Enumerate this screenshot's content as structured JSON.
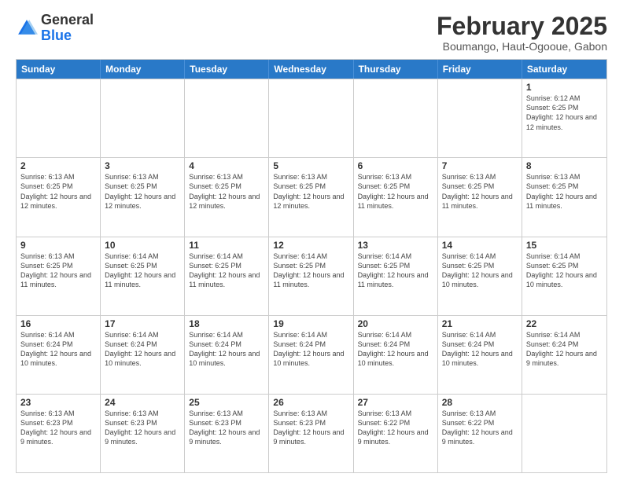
{
  "header": {
    "logo": {
      "general": "General",
      "blue": "Blue"
    },
    "title": "February 2025",
    "subtitle": "Boumango, Haut-Ogooue, Gabon"
  },
  "days_of_week": [
    "Sunday",
    "Monday",
    "Tuesday",
    "Wednesday",
    "Thursday",
    "Friday",
    "Saturday"
  ],
  "weeks": [
    [
      {
        "day": "",
        "info": ""
      },
      {
        "day": "",
        "info": ""
      },
      {
        "day": "",
        "info": ""
      },
      {
        "day": "",
        "info": ""
      },
      {
        "day": "",
        "info": ""
      },
      {
        "day": "",
        "info": ""
      },
      {
        "day": "1",
        "info": "Sunrise: 6:12 AM\nSunset: 6:25 PM\nDaylight: 12 hours and 12 minutes."
      }
    ],
    [
      {
        "day": "2",
        "info": "Sunrise: 6:13 AM\nSunset: 6:25 PM\nDaylight: 12 hours and 12 minutes."
      },
      {
        "day": "3",
        "info": "Sunrise: 6:13 AM\nSunset: 6:25 PM\nDaylight: 12 hours and 12 minutes."
      },
      {
        "day": "4",
        "info": "Sunrise: 6:13 AM\nSunset: 6:25 PM\nDaylight: 12 hours and 12 minutes."
      },
      {
        "day": "5",
        "info": "Sunrise: 6:13 AM\nSunset: 6:25 PM\nDaylight: 12 hours and 12 minutes."
      },
      {
        "day": "6",
        "info": "Sunrise: 6:13 AM\nSunset: 6:25 PM\nDaylight: 12 hours and 11 minutes."
      },
      {
        "day": "7",
        "info": "Sunrise: 6:13 AM\nSunset: 6:25 PM\nDaylight: 12 hours and 11 minutes."
      },
      {
        "day": "8",
        "info": "Sunrise: 6:13 AM\nSunset: 6:25 PM\nDaylight: 12 hours and 11 minutes."
      }
    ],
    [
      {
        "day": "9",
        "info": "Sunrise: 6:13 AM\nSunset: 6:25 PM\nDaylight: 12 hours and 11 minutes."
      },
      {
        "day": "10",
        "info": "Sunrise: 6:14 AM\nSunset: 6:25 PM\nDaylight: 12 hours and 11 minutes."
      },
      {
        "day": "11",
        "info": "Sunrise: 6:14 AM\nSunset: 6:25 PM\nDaylight: 12 hours and 11 minutes."
      },
      {
        "day": "12",
        "info": "Sunrise: 6:14 AM\nSunset: 6:25 PM\nDaylight: 12 hours and 11 minutes."
      },
      {
        "day": "13",
        "info": "Sunrise: 6:14 AM\nSunset: 6:25 PM\nDaylight: 12 hours and 11 minutes."
      },
      {
        "day": "14",
        "info": "Sunrise: 6:14 AM\nSunset: 6:25 PM\nDaylight: 12 hours and 10 minutes."
      },
      {
        "day": "15",
        "info": "Sunrise: 6:14 AM\nSunset: 6:25 PM\nDaylight: 12 hours and 10 minutes."
      }
    ],
    [
      {
        "day": "16",
        "info": "Sunrise: 6:14 AM\nSunset: 6:24 PM\nDaylight: 12 hours and 10 minutes."
      },
      {
        "day": "17",
        "info": "Sunrise: 6:14 AM\nSunset: 6:24 PM\nDaylight: 12 hours and 10 minutes."
      },
      {
        "day": "18",
        "info": "Sunrise: 6:14 AM\nSunset: 6:24 PM\nDaylight: 12 hours and 10 minutes."
      },
      {
        "day": "19",
        "info": "Sunrise: 6:14 AM\nSunset: 6:24 PM\nDaylight: 12 hours and 10 minutes."
      },
      {
        "day": "20",
        "info": "Sunrise: 6:14 AM\nSunset: 6:24 PM\nDaylight: 12 hours and 10 minutes."
      },
      {
        "day": "21",
        "info": "Sunrise: 6:14 AM\nSunset: 6:24 PM\nDaylight: 12 hours and 10 minutes."
      },
      {
        "day": "22",
        "info": "Sunrise: 6:14 AM\nSunset: 6:24 PM\nDaylight: 12 hours and 9 minutes."
      }
    ],
    [
      {
        "day": "23",
        "info": "Sunrise: 6:13 AM\nSunset: 6:23 PM\nDaylight: 12 hours and 9 minutes."
      },
      {
        "day": "24",
        "info": "Sunrise: 6:13 AM\nSunset: 6:23 PM\nDaylight: 12 hours and 9 minutes."
      },
      {
        "day": "25",
        "info": "Sunrise: 6:13 AM\nSunset: 6:23 PM\nDaylight: 12 hours and 9 minutes."
      },
      {
        "day": "26",
        "info": "Sunrise: 6:13 AM\nSunset: 6:23 PM\nDaylight: 12 hours and 9 minutes."
      },
      {
        "day": "27",
        "info": "Sunrise: 6:13 AM\nSunset: 6:22 PM\nDaylight: 12 hours and 9 minutes."
      },
      {
        "day": "28",
        "info": "Sunrise: 6:13 AM\nSunset: 6:22 PM\nDaylight: 12 hours and 9 minutes."
      },
      {
        "day": "",
        "info": ""
      }
    ]
  ]
}
